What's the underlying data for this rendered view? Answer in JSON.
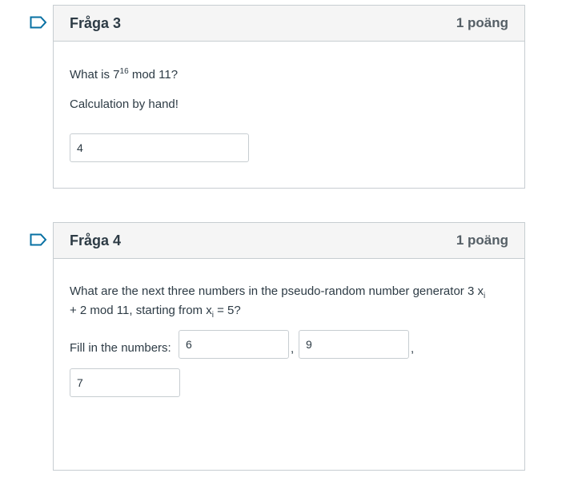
{
  "questions": [
    {
      "title": "Fråga 3",
      "points": "1 poäng",
      "text_prefix": "What is 7",
      "exponent": "16",
      "text_suffix": " mod 11?",
      "note": "Calculation by hand!",
      "answer": "4"
    },
    {
      "title": "Fråga 4",
      "points": "1 poäng",
      "line1_a": "What are the next three numbers in the pseudo-random number generator 3 x",
      "line1_sub": "i",
      "line2_a": "+ 2 mod 11, starting from x",
      "line2_sub": "i",
      "line2_b": " = 5?",
      "fill_label": "Fill in the numbers:",
      "answers": [
        "6",
        "9",
        "7"
      ],
      "separator": ","
    }
  ]
}
